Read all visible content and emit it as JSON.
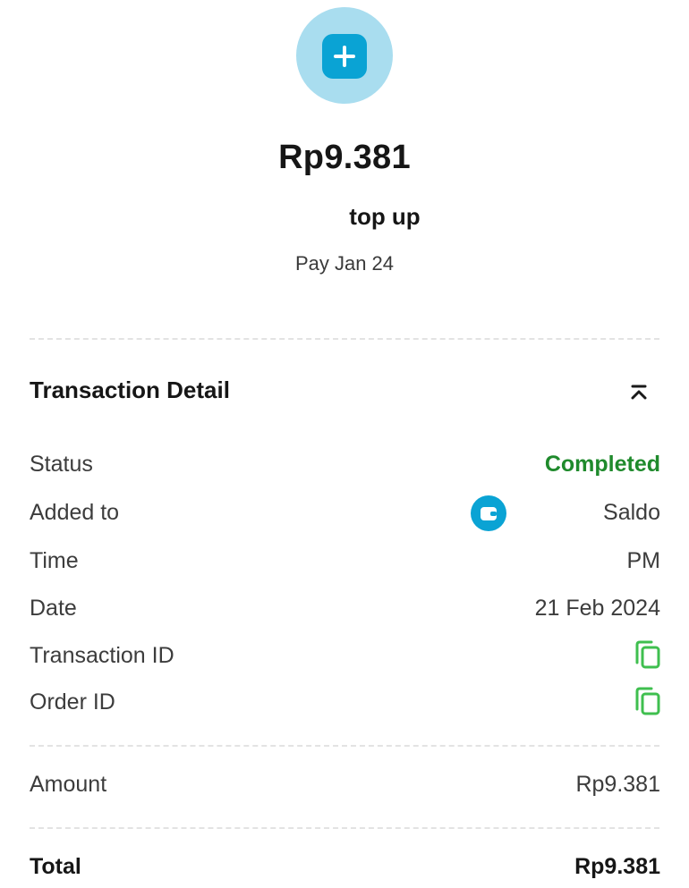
{
  "header": {
    "icon": "plus-square-icon",
    "amount": "Rp9.381",
    "type": "top up",
    "pay_date": "Pay Jan 24"
  },
  "detail": {
    "section_title": "Transaction Detail",
    "collapse_icon": "chevron-up-double-icon",
    "rows": [
      {
        "label": "Status",
        "value": "Completed",
        "value_color": "#1f8a2c"
      },
      {
        "label": "Added to",
        "value": "Saldo",
        "icon": "wallet-icon"
      },
      {
        "label": "Time",
        "value": "PM"
      },
      {
        "label": "Date",
        "value": "21 Feb 2024"
      },
      {
        "label": "Transaction ID",
        "value": "",
        "icon": "copy-icon"
      },
      {
        "label": "Order ID",
        "value": "",
        "icon": "copy-icon"
      }
    ]
  },
  "amount": {
    "label": "Amount",
    "value": "Rp9.381"
  },
  "total": {
    "label": "Total",
    "value": "Rp9.381"
  },
  "colors": {
    "accent": "#0aa3d4",
    "accent_light": "#a9ddef",
    "success": "#1f8a2c",
    "copy_icon": "#3fbf4f"
  }
}
